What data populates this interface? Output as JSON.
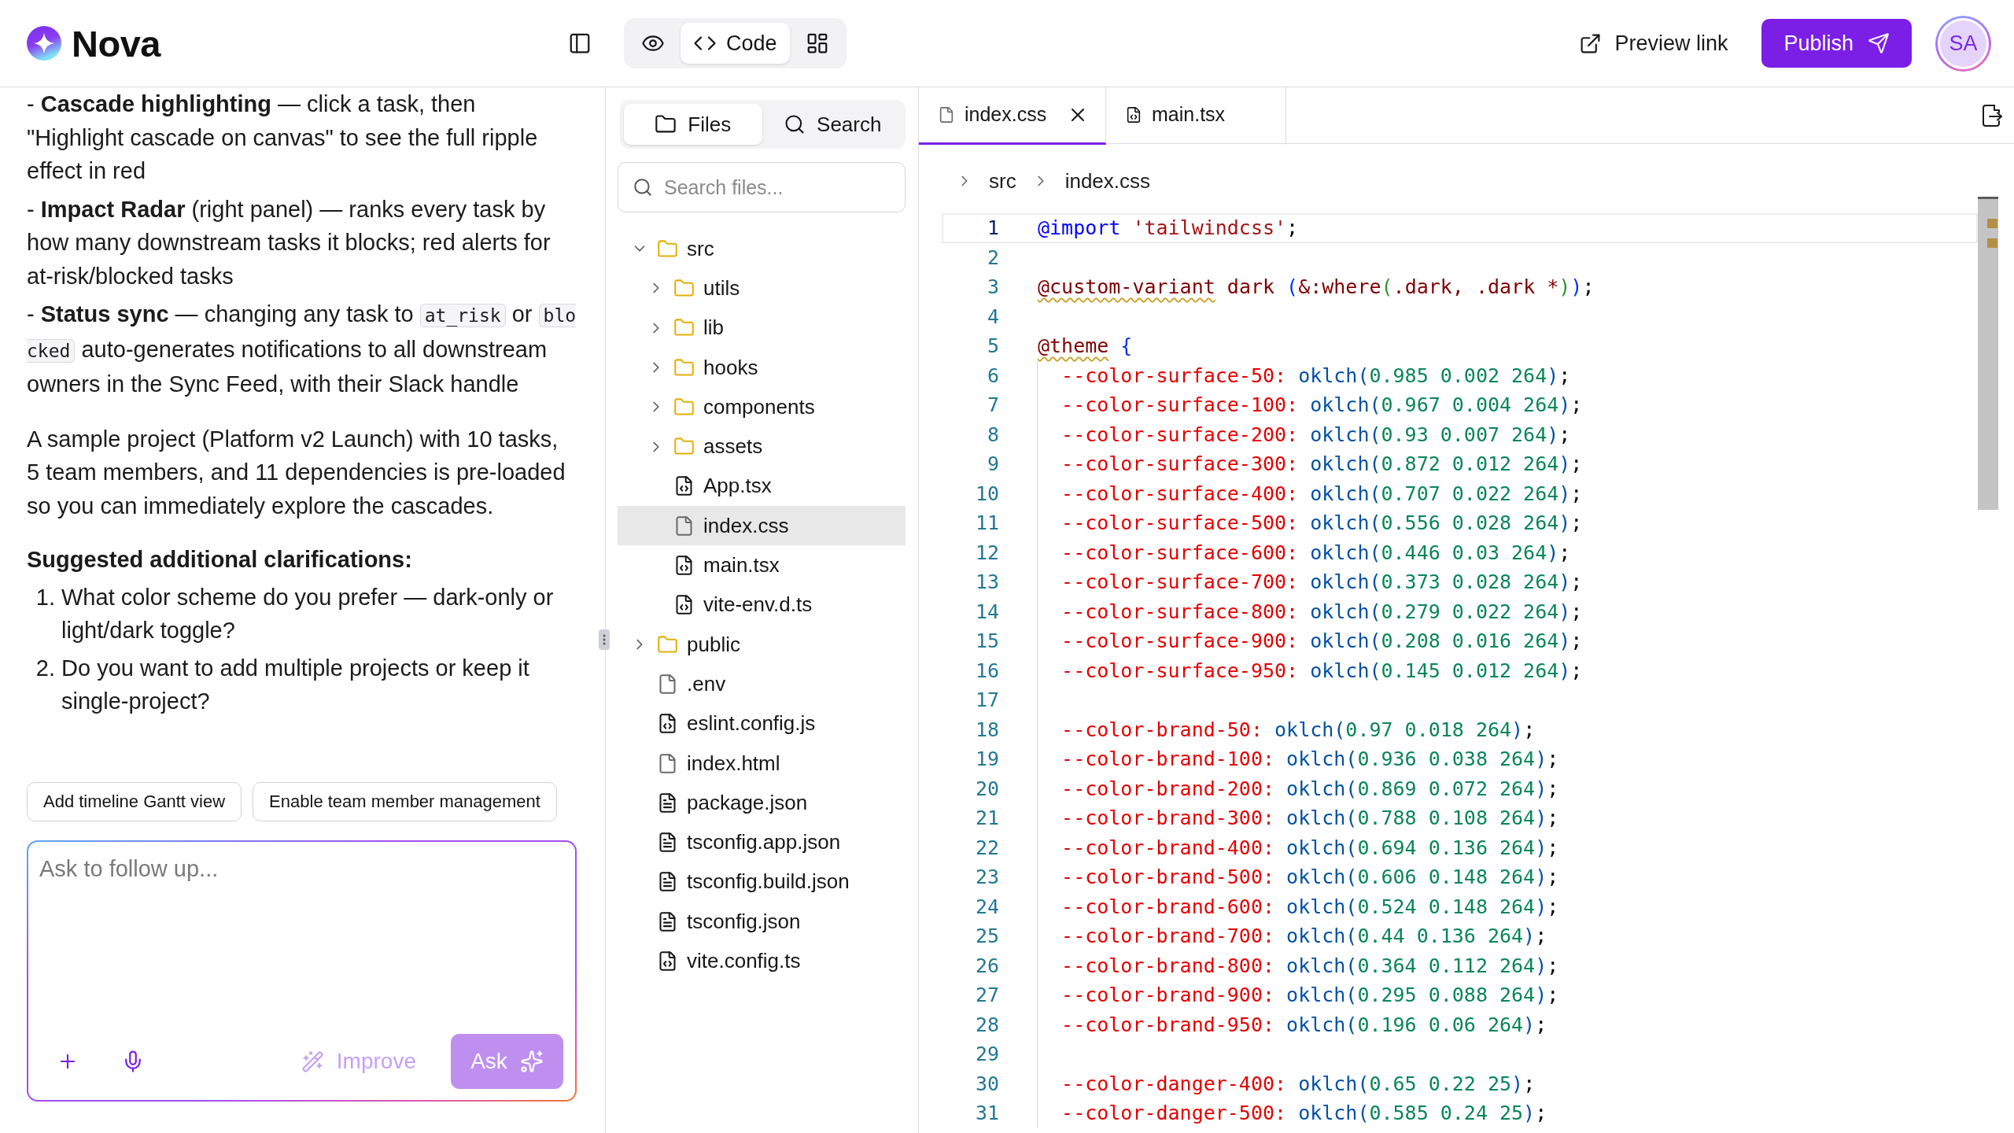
{
  "header": {
    "brand": "Nova",
    "view_toggle": [
      {
        "kind": "preview",
        "selected": false
      },
      {
        "kind": "code",
        "label": "Code",
        "selected": true
      },
      {
        "kind": "layout",
        "selected": false
      }
    ],
    "preview_link": "Preview link",
    "publish": "Publish",
    "avatar": "SA"
  },
  "chat": {
    "bullets": [
      [
        {
          "kind": "text",
          "text": "- **Cascade highlighting** — click a task, then \"Highlight cascade on canvas\" to see the full ripple effect in red"
        }
      ],
      [
        {
          "kind": "text",
          "text": "- **Impact Radar** (right panel) — ranks every task by how many downstream tasks it blocks; red alerts for at-risk/blocked tasks"
        }
      ],
      [
        {
          "kind": "text",
          "text": "- **Status sync** — changing any task to "
        },
        {
          "kind": "code",
          "text": "at_risk"
        },
        {
          "kind": "text",
          "text": " or "
        },
        {
          "kind": "code",
          "text": "blocked"
        },
        {
          "kind": "text",
          "text": " auto-generates notifications to all downstream owners in the Sync Feed, with their Slack handle"
        }
      ]
    ],
    "summary": "A sample project (Platform v2 Launch) with 10 tasks, 5 team members, and 11 dependencies is pre-loaded so you can immediately explore the cascades.",
    "clarifications_heading": "Suggested additional clarifications:",
    "clarifications": [
      {
        "marker": "1.",
        "text": "What color scheme do you prefer — dark-only or light/dark toggle?"
      },
      {
        "marker": "2.",
        "text": "Do you want to add multiple projects or keep it single-project?"
      }
    ],
    "suggestions": [
      "Add timeline Gantt view",
      "Enable team member management"
    ],
    "composer": {
      "placeholder": "Ask to follow up...",
      "improve": {
        "label": "Improve",
        "disabled": true
      },
      "ask": {
        "label": "Ask",
        "disabled": true
      }
    }
  },
  "files": {
    "tabs": [
      {
        "label": "Files",
        "kind": "files",
        "selected": true
      },
      {
        "label": "Search",
        "kind": "search",
        "selected": false
      }
    ],
    "search_placeholder": "Search files...",
    "tree": [
      {
        "name": "src",
        "kind": "folder",
        "expanded": true,
        "selected": false,
        "children": [
          {
            "name": "utils",
            "kind": "folder",
            "expanded": false,
            "selected": false
          },
          {
            "name": "lib",
            "kind": "folder",
            "expanded": false,
            "selected": false
          },
          {
            "name": "hooks",
            "kind": "folder",
            "expanded": false,
            "selected": false
          },
          {
            "name": "components",
            "kind": "folder",
            "expanded": false,
            "selected": false
          },
          {
            "name": "assets",
            "kind": "folder",
            "expanded": false,
            "selected": false
          },
          {
            "name": "App.tsx",
            "kind": "code",
            "selected": false
          },
          {
            "name": "index.css",
            "kind": "plain",
            "selected": true
          },
          {
            "name": "main.tsx",
            "kind": "code",
            "selected": false
          },
          {
            "name": "vite-env.d.ts",
            "kind": "code",
            "selected": false
          }
        ]
      },
      {
        "name": "public",
        "kind": "folder",
        "expanded": false,
        "selected": false
      },
      {
        "name": ".env",
        "kind": "plain",
        "selected": false
      },
      {
        "name": "eslint.config.js",
        "kind": "code",
        "selected": false
      },
      {
        "name": "index.html",
        "kind": "plain",
        "selected": false
      },
      {
        "name": "package.json",
        "kind": "text",
        "selected": false
      },
      {
        "name": "tsconfig.app.json",
        "kind": "text",
        "selected": false
      },
      {
        "name": "tsconfig.build.json",
        "kind": "text",
        "selected": false
      },
      {
        "name": "tsconfig.json",
        "kind": "text",
        "selected": false
      },
      {
        "name": "vite.config.ts",
        "kind": "code",
        "selected": false
      }
    ]
  },
  "editor": {
    "tabs": [
      {
        "label": "index.css",
        "kind": "plain",
        "selected": true
      },
      {
        "label": "main.tsx",
        "kind": "code",
        "selected": false
      }
    ],
    "breadcrumb": [
      "src",
      "index.css"
    ],
    "lines": [
      {
        "number": "1",
        "active": true,
        "kind": "top",
        "tokens": [
          {
            "kind": "at_rule",
            "text": "@import"
          },
          {
            "kind": "string",
            "text": " 'tailwindcss'"
          },
          {
            "kind": "punct",
            "text": ";"
          }
        ]
      },
      {
        "number": "2",
        "active": false,
        "kind": "top"
      },
      {
        "number": "3",
        "active": false,
        "kind": "top",
        "tokens": [
          {
            "kind": "unknown_at_rule",
            "text": "@custom-variant"
          },
          {
            "kind": "selector",
            "text": " dark "
          },
          {
            "kind": "bracket_1",
            "text": "("
          },
          {
            "kind": "selector",
            "text": "&:where"
          },
          {
            "kind": "bracket_2",
            "text": "("
          },
          {
            "kind": "selector",
            "text": ".dark, .dark *"
          },
          {
            "kind": "bracket_2",
            "text": ")"
          },
          {
            "kind": "bracket_1",
            "text": ")"
          },
          {
            "kind": "punct",
            "text": ";"
          }
        ]
      },
      {
        "number": "4",
        "active": false,
        "kind": "top"
      },
      {
        "number": "5",
        "active": false,
        "kind": "top",
        "tokens": [
          {
            "kind": "unknown_at_rule",
            "text": "@theme"
          },
          {
            "kind": "bracket_1",
            "text": " {"
          }
        ]
      },
      {
        "number": "6",
        "active": false,
        "kind": "inner",
        "tokens": [
          {
            "kind": "property",
            "text": "  --color-surface-50:"
          },
          {
            "kind": "function",
            "text": " oklch("
          },
          {
            "kind": "number",
            "text": "0.985 0.002 264"
          },
          {
            "kind": "function",
            "text": ")"
          },
          {
            "kind": "punct",
            "text": ";"
          }
        ]
      },
      {
        "number": "7",
        "active": false,
        "kind": "inner",
        "tokens": [
          {
            "kind": "property",
            "text": "  --color-surface-100:"
          },
          {
            "kind": "function",
            "text": " oklch("
          },
          {
            "kind": "number",
            "text": "0.967 0.004 264"
          },
          {
            "kind": "function",
            "text": ")"
          },
          {
            "kind": "punct",
            "text": ";"
          }
        ]
      },
      {
        "number": "8",
        "active": false,
        "kind": "inner",
        "tokens": [
          {
            "kind": "property",
            "text": "  --color-surface-200:"
          },
          {
            "kind": "function",
            "text": " oklch("
          },
          {
            "kind": "number",
            "text": "0.93 0.007 264"
          },
          {
            "kind": "function",
            "text": ")"
          },
          {
            "kind": "punct",
            "text": ";"
          }
        ]
      },
      {
        "number": "9",
        "active": false,
        "kind": "inner",
        "tokens": [
          {
            "kind": "property",
            "text": "  --color-surface-300:"
          },
          {
            "kind": "function",
            "text": " oklch("
          },
          {
            "kind": "number",
            "text": "0.872 0.012 264"
          },
          {
            "kind": "function",
            "text": ")"
          },
          {
            "kind": "punct",
            "text": ";"
          }
        ]
      },
      {
        "number": "10",
        "active": false,
        "kind": "inner",
        "tokens": [
          {
            "kind": "property",
            "text": "  --color-surface-400:"
          },
          {
            "kind": "function",
            "text": " oklch("
          },
          {
            "kind": "number",
            "text": "0.707 0.022 264"
          },
          {
            "kind": "function",
            "text": ")"
          },
          {
            "kind": "punct",
            "text": ";"
          }
        ]
      },
      {
        "number": "11",
        "active": false,
        "kind": "inner",
        "tokens": [
          {
            "kind": "property",
            "text": "  --color-surface-500:"
          },
          {
            "kind": "function",
            "text": " oklch("
          },
          {
            "kind": "number",
            "text": "0.556 0.028 264"
          },
          {
            "kind": "function",
            "text": ")"
          },
          {
            "kind": "punct",
            "text": ";"
          }
        ]
      },
      {
        "number": "12",
        "active": false,
        "kind": "inner",
        "tokens": [
          {
            "kind": "property",
            "text": "  --color-surface-600:"
          },
          {
            "kind": "function",
            "text": " oklch("
          },
          {
            "kind": "number",
            "text": "0.446 0.03 264"
          },
          {
            "kind": "function",
            "text": ")"
          },
          {
            "kind": "punct",
            "text": ";"
          }
        ]
      },
      {
        "number": "13",
        "active": false,
        "kind": "inner",
        "tokens": [
          {
            "kind": "property",
            "text": "  --color-surface-700:"
          },
          {
            "kind": "function",
            "text": " oklch("
          },
          {
            "kind": "number",
            "text": "0.373 0.028 264"
          },
          {
            "kind": "function",
            "text": ")"
          },
          {
            "kind": "punct",
            "text": ";"
          }
        ]
      },
      {
        "number": "14",
        "active": false,
        "kind": "inner",
        "tokens": [
          {
            "kind": "property",
            "text": "  --color-surface-800:"
          },
          {
            "kind": "function",
            "text": " oklch("
          },
          {
            "kind": "number",
            "text": "0.279 0.022 264"
          },
          {
            "kind": "function",
            "text": ")"
          },
          {
            "kind": "punct",
            "text": ";"
          }
        ]
      },
      {
        "number": "15",
        "active": false,
        "kind": "inner",
        "tokens": [
          {
            "kind": "property",
            "text": "  --color-surface-900:"
          },
          {
            "kind": "function",
            "text": " oklch("
          },
          {
            "kind": "number",
            "text": "0.208 0.016 264"
          },
          {
            "kind": "function",
            "text": ")"
          },
          {
            "kind": "punct",
            "text": ";"
          }
        ]
      },
      {
        "number": "16",
        "active": false,
        "kind": "inner",
        "tokens": [
          {
            "kind": "property",
            "text": "  --color-surface-950:"
          },
          {
            "kind": "function",
            "text": " oklch("
          },
          {
            "kind": "number",
            "text": "0.145 0.012 264"
          },
          {
            "kind": "function",
            "text": ")"
          },
          {
            "kind": "punct",
            "text": ";"
          }
        ]
      },
      {
        "number": "17",
        "active": false,
        "kind": "inner"
      },
      {
        "number": "18",
        "active": false,
        "kind": "inner",
        "tokens": [
          {
            "kind": "property",
            "text": "  --color-brand-50:"
          },
          {
            "kind": "function",
            "text": " oklch("
          },
          {
            "kind": "number",
            "text": "0.97 0.018 264"
          },
          {
            "kind": "function",
            "text": ")"
          },
          {
            "kind": "punct",
            "text": ";"
          }
        ]
      },
      {
        "number": "19",
        "active": false,
        "kind": "inner",
        "tokens": [
          {
            "kind": "property",
            "text": "  --color-brand-100:"
          },
          {
            "kind": "function",
            "text": " oklch("
          },
          {
            "kind": "number",
            "text": "0.936 0.038 264"
          },
          {
            "kind": "function",
            "text": ")"
          },
          {
            "kind": "punct",
            "text": ";"
          }
        ]
      },
      {
        "number": "20",
        "active": false,
        "kind": "inner",
        "tokens": [
          {
            "kind": "property",
            "text": "  --color-brand-200:"
          },
          {
            "kind": "function",
            "text": " oklch("
          },
          {
            "kind": "number",
            "text": "0.869 0.072 264"
          },
          {
            "kind": "function",
            "text": ")"
          },
          {
            "kind": "punct",
            "text": ";"
          }
        ]
      },
      {
        "number": "21",
        "active": false,
        "kind": "inner",
        "tokens": [
          {
            "kind": "property",
            "text": "  --color-brand-300:"
          },
          {
            "kind": "function",
            "text": " oklch("
          },
          {
            "kind": "number",
            "text": "0.788 0.108 264"
          },
          {
            "kind": "function",
            "text": ")"
          },
          {
            "kind": "punct",
            "text": ";"
          }
        ]
      },
      {
        "number": "22",
        "active": false,
        "kind": "inner",
        "tokens": [
          {
            "kind": "property",
            "text": "  --color-brand-400:"
          },
          {
            "kind": "function",
            "text": " oklch("
          },
          {
            "kind": "number",
            "text": "0.694 0.136 264"
          },
          {
            "kind": "function",
            "text": ")"
          },
          {
            "kind": "punct",
            "text": ";"
          }
        ]
      },
      {
        "number": "23",
        "active": false,
        "kind": "inner",
        "tokens": [
          {
            "kind": "property",
            "text": "  --color-brand-500:"
          },
          {
            "kind": "function",
            "text": " oklch("
          },
          {
            "kind": "number",
            "text": "0.606 0.148 264"
          },
          {
            "kind": "function",
            "text": ")"
          },
          {
            "kind": "punct",
            "text": ";"
          }
        ]
      },
      {
        "number": "24",
        "active": false,
        "kind": "inner",
        "tokens": [
          {
            "kind": "property",
            "text": "  --color-brand-600:"
          },
          {
            "kind": "function",
            "text": " oklch("
          },
          {
            "kind": "number",
            "text": "0.524 0.148 264"
          },
          {
            "kind": "function",
            "text": ")"
          },
          {
            "kind": "punct",
            "text": ";"
          }
        ]
      },
      {
        "number": "25",
        "active": false,
        "kind": "inner",
        "tokens": [
          {
            "kind": "property",
            "text": "  --color-brand-700:"
          },
          {
            "kind": "function",
            "text": " oklch("
          },
          {
            "kind": "number",
            "text": "0.44 0.136 264"
          },
          {
            "kind": "function",
            "text": ")"
          },
          {
            "kind": "punct",
            "text": ";"
          }
        ]
      },
      {
        "number": "26",
        "active": false,
        "kind": "inner",
        "tokens": [
          {
            "kind": "property",
            "text": "  --color-brand-800:"
          },
          {
            "kind": "function",
            "text": " oklch("
          },
          {
            "kind": "number",
            "text": "0.364 0.112 264"
          },
          {
            "kind": "function",
            "text": ")"
          },
          {
            "kind": "punct",
            "text": ";"
          }
        ]
      },
      {
        "number": "27",
        "active": false,
        "kind": "inner",
        "tokens": [
          {
            "kind": "property",
            "text": "  --color-brand-900:"
          },
          {
            "kind": "function",
            "text": " oklch("
          },
          {
            "kind": "number",
            "text": "0.295 0.088 264"
          },
          {
            "kind": "function",
            "text": ")"
          },
          {
            "kind": "punct",
            "text": ";"
          }
        ]
      },
      {
        "number": "28",
        "active": false,
        "kind": "inner",
        "tokens": [
          {
            "kind": "property",
            "text": "  --color-brand-950:"
          },
          {
            "kind": "function",
            "text": " oklch("
          },
          {
            "kind": "number",
            "text": "0.196 0.06 264"
          },
          {
            "kind": "function",
            "text": ")"
          },
          {
            "kind": "punct",
            "text": ";"
          }
        ]
      },
      {
        "number": "29",
        "active": false,
        "kind": "inner"
      },
      {
        "number": "30",
        "active": false,
        "kind": "inner",
        "tokens": [
          {
            "kind": "property",
            "text": "  --color-danger-400:"
          },
          {
            "kind": "function",
            "text": " oklch("
          },
          {
            "kind": "number",
            "text": "0.65 0.22 25"
          },
          {
            "kind": "function",
            "text": ")"
          },
          {
            "kind": "punct",
            "text": ";"
          }
        ]
      },
      {
        "number": "31",
        "active": false,
        "kind": "inner",
        "tokens": [
          {
            "kind": "property",
            "text": "  --color-danger-500:"
          },
          {
            "kind": "function",
            "text": " oklch("
          },
          {
            "kind": "number",
            "text": "0.585 0.24 25"
          },
          {
            "kind": "function",
            "text": ")"
          },
          {
            "kind": "punct",
            "text": ";"
          }
        ]
      }
    ]
  }
}
